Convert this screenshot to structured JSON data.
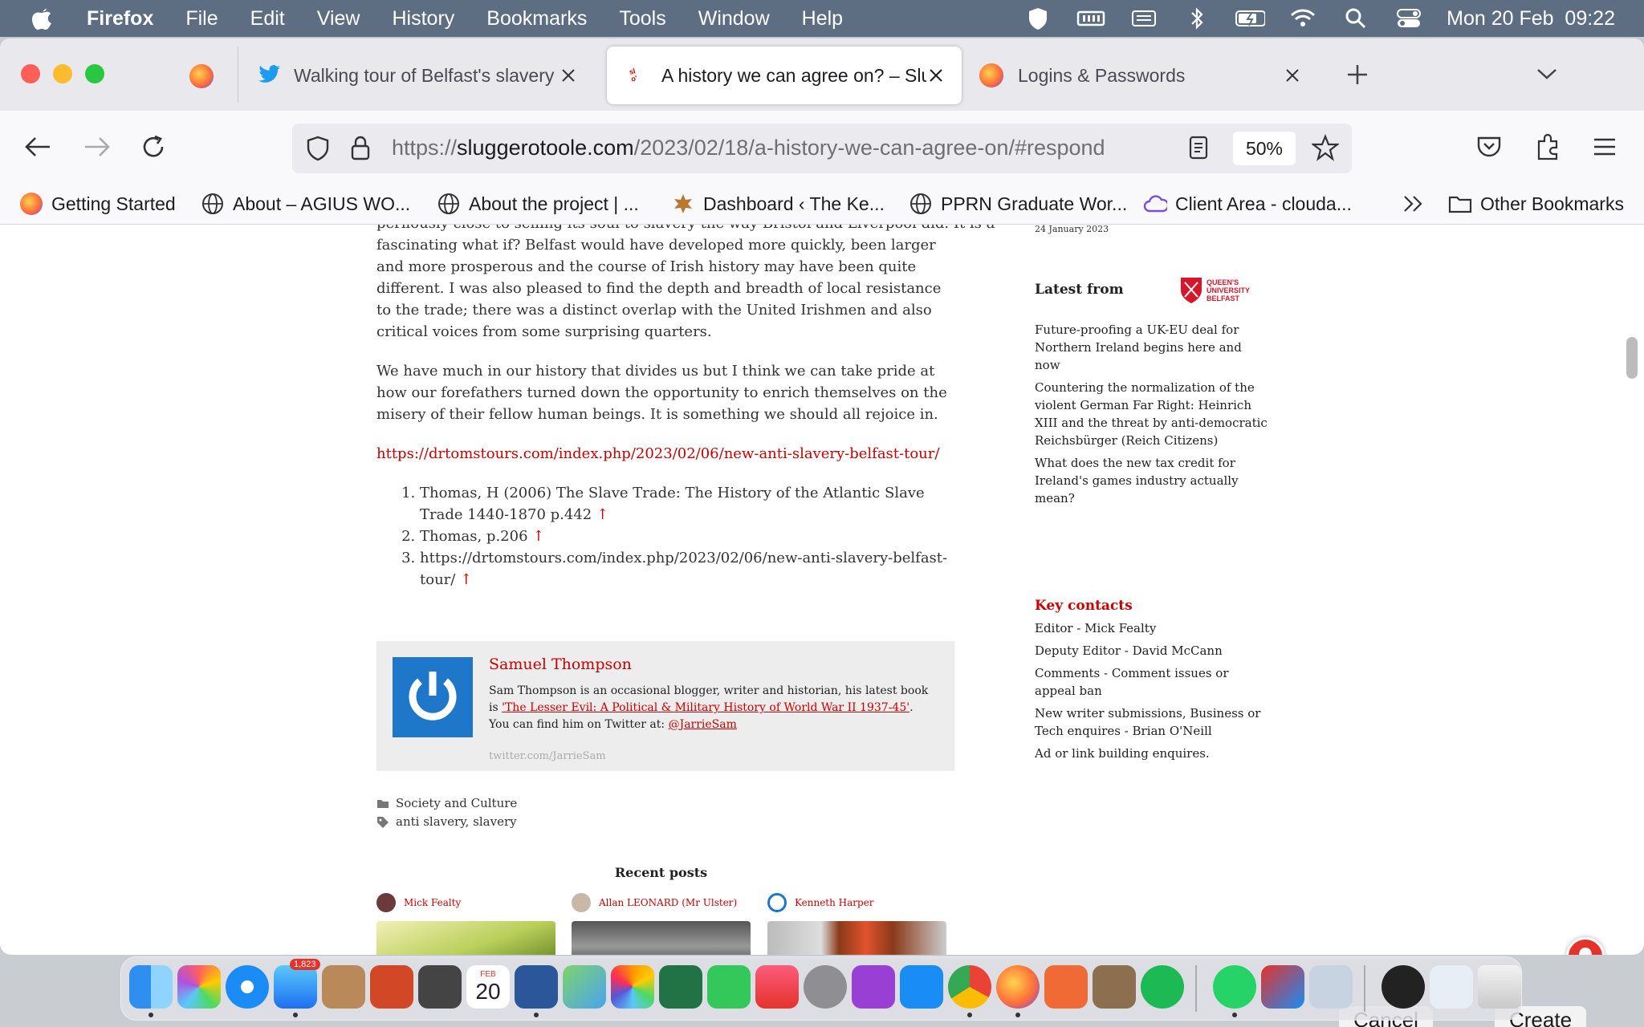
{
  "menubar": {
    "app_name": "Firefox",
    "items": [
      "File",
      "Edit",
      "View",
      "History",
      "Bookmarks",
      "Tools",
      "Window",
      "Help"
    ],
    "clock": "Mon 20 Feb  09:22"
  },
  "tabs": [
    {
      "title": "Walking tour of Belfast's slavery",
      "icon": "twitter-icon"
    },
    {
      "title": "A history we can agree on? – Slu",
      "icon": "slugger-otoole-icon",
      "active": true
    },
    {
      "title": "Logins & Passwords",
      "icon": "firefox-icon"
    }
  ],
  "urlbar": {
    "scheme": "https://",
    "host": "sluggerotoole.com",
    "path": "/2023/02/18/a-history-we-can-agree-on/#respond",
    "zoom": "50%"
  },
  "bookmarks": [
    "Getting Started",
    "About – AGIUS WO...",
    "About the project | ...",
    "Dashboard ‹ The Ke...",
    "PPRN Graduate Wor...",
    "Client Area - clouda..."
  ],
  "other_bookmarks": "Other Bookmarks",
  "article": {
    "cut_line": "perilously close to selling its soul to slavery the way Bristol and Liverpool did. It is a",
    "para1": "fascinating what if? Belfast would have developed more quickly, been larger and more prosperous and the course of Irish history may have been quite different. I was also pleased to find the depth and breadth of local resistance to the trade; there was a distinct overlap with the United Irishmen and also critical voices from some surprising quarters.",
    "para2": "We have much in our history that divides us but I think we can take pride at how our forefathers turned down the opportunity to enrich themselves on the misery of their fellow human beings. It is something we should all rejoice in.",
    "link": "https://drtomstours.com/index.php/2023/02/06/new-anti-slavery-belfast-tour/",
    "refs": [
      "Thomas, H (2006) The Slave Trade: The History of the Atlantic Slave Trade 1440-1870 p.442",
      "Thomas, p.206",
      "https://drtomstours.com/index.php/2023/02/06/new-anti-slavery-belfast-tour/"
    ],
    "ref_arrow": "↑"
  },
  "author": {
    "name": "Samuel Thompson",
    "bio_prefix": "Sam Thompson is an occasional blogger, writer and historian, his latest book is ",
    "book_link": "'The Lesser Evil: A Political & Military History of World War II 1937-45'",
    "bio_suffix": ".",
    "twitter_prefix": "You can find him on Twitter at: ",
    "twitter_handle": "@JarrieSam",
    "twitter_url": "twitter.com/JarrieSam"
  },
  "meta": {
    "category": "Society and Culture",
    "tags": "anti slavery, slavery"
  },
  "recent": {
    "title": "Recent posts",
    "authors": [
      "Mick Fealty",
      "Allan LEONARD (Mr Ulster)",
      "Kenneth Harper"
    ]
  },
  "sidebar": {
    "date": "24 January 2023",
    "latest_head": "Latest from",
    "qub_logo_text": "QUEEN'S UNIVERSITY BELFAST",
    "latest_links": [
      "Future-proofing a UK-EU deal for Northern Ireland begins here and now",
      "Countering the normalization of the violent German Far Right: Heinrich XIII and the threat by anti-democratic Reichsbürger (Reich Citizens)",
      "What does the new tax credit for Ireland's games industry actually mean?"
    ],
    "key_head": "Key contacts",
    "key_links": [
      "Editor - Mick Fealty",
      "Deputy Editor - David McCann",
      "Comments - Comment issues or appeal ban",
      "New writer submissions, Business or Tech enquires - Brian O'Neill",
      "Ad or link building enquires."
    ]
  },
  "dock": {
    "mail_badge": "1,823",
    "calendar_month": "FEB",
    "calendar_day": "20"
  },
  "background_buttons": {
    "cancel": "Cancel",
    "create": "Create"
  },
  "colors": {
    "accent_red": "#c80000",
    "menubar_bg": "#5d6d82"
  }
}
